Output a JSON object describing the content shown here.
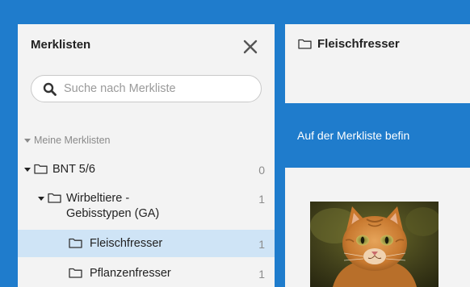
{
  "sidebar": {
    "title": "Merklisten",
    "close_icon": "close-icon",
    "search": {
      "placeholder": "Suche nach Merkliste",
      "value": ""
    },
    "section_label": "Meine Merklisten",
    "items": [
      {
        "label": "BNT 5/6",
        "count": "0",
        "expanded": true,
        "level": 0
      },
      {
        "label_line1": "Wirbeltiere -",
        "label_line2": "Gebisstypen (GA)",
        "count": "1",
        "expanded": true,
        "level": 1
      },
      {
        "label": "Fleischfresser",
        "count": "1",
        "selected": true,
        "level": 2
      },
      {
        "label": "Pflanzenfresser",
        "count": "1",
        "level": 2
      }
    ]
  },
  "main": {
    "title": "Fleischfresser",
    "info_text": "Auf der Merkliste befin",
    "thumbnail": "cat-photo"
  },
  "colors": {
    "brand_blue": "#1f7ccc",
    "panel_bg": "#f3f3f3",
    "selected_bg": "#cfe4f6"
  }
}
